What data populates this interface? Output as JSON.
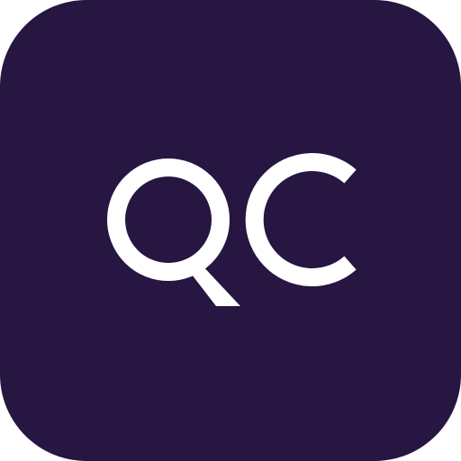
{
  "app_icon": {
    "logo_text": "QC",
    "logo_parts": [
      "Q",
      "C"
    ],
    "background_color": "#271542",
    "foreground_color": "#ffffff"
  }
}
